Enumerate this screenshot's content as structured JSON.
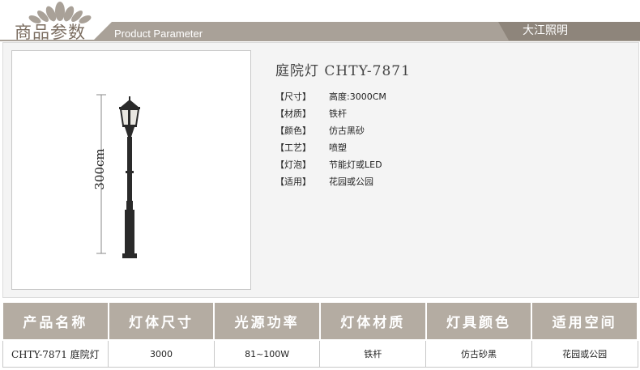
{
  "header": {
    "title": "商品参数",
    "subtitle": "Product Parameter",
    "brand": "大江照明",
    "colors": {
      "band": "#a9a198",
      "band_dark": "#8e857b",
      "accent": "#7b6d60"
    }
  },
  "product": {
    "title": "庭院灯 CHTY-7871",
    "height_label": "300cm",
    "specs": [
      {
        "key": "【尺寸】",
        "value": "高度:3000CM"
      },
      {
        "key": "【材质】",
        "value": "铁杆"
      },
      {
        "key": "【颜色】",
        "value": "仿古黑砂"
      },
      {
        "key": "【工艺】",
        "value": "喷塑"
      },
      {
        "key": "【灯泡】",
        "value": "节能灯或LED"
      },
      {
        "key": "【适用】",
        "value": "花园或公园"
      }
    ]
  },
  "table": {
    "headers": [
      "产品名称",
      "灯体尺寸",
      "光源功率",
      "灯体材质",
      "灯具颜色",
      "适用空间"
    ],
    "row": [
      "CHTY-7871 庭院灯",
      "3000",
      "81~100W",
      "铁杆",
      "仿古砂黑",
      "花园或公园"
    ]
  }
}
